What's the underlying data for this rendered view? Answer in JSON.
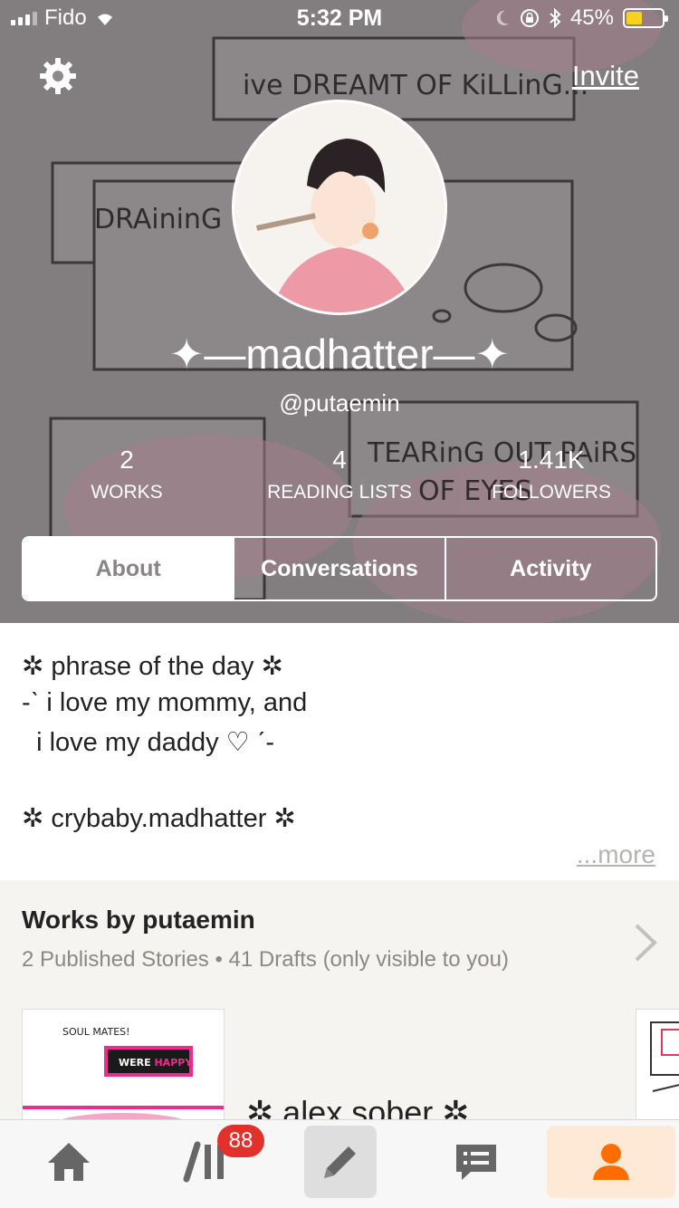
{
  "status_bar": {
    "carrier": "Fido",
    "time": "5:32 PM",
    "battery_percent": "45%",
    "battery_level": 0.45,
    "icons": [
      "signal-icon",
      "wifi-icon",
      "moon-icon",
      "rotation-lock-icon",
      "bluetooth-icon",
      "battery-icon"
    ]
  },
  "header": {
    "settings_icon": "gear-icon",
    "invite_label": "Invite",
    "display_name": "✦—madhatter—✦",
    "username": "@putaemin"
  },
  "stats": [
    {
      "value": "2",
      "label": "WORKS"
    },
    {
      "value": "4",
      "label": "READING LISTS"
    },
    {
      "value": "1.41K",
      "label": "FOLLOWERS"
    }
  ],
  "tabs": [
    {
      "label": "About",
      "active": true
    },
    {
      "label": "Conversations",
      "active": false
    },
    {
      "label": "Activity",
      "active": false
    }
  ],
  "about": {
    "lines": [
      "✲ phrase of the day ✲",
      "-ˋ i love my mommy, and",
      "  i love my daddy ♡ ˊ-",
      "",
      "✲ crybaby.madhatter ✲"
    ],
    "more_label": "...more"
  },
  "works": {
    "title": "Works by putaemin",
    "subtitle": "2 Published Stories • 41 Drafts (only visible to you)",
    "first_story_title": "✲ alex sober ✲",
    "cover_text_1": "SOUL MATES!",
    "cover_text_2_a": "WERE ",
    "cover_text_2_b": "HAPPY."
  },
  "tabbar": {
    "items": [
      "home-icon",
      "library-icon",
      "write-icon",
      "messages-icon",
      "profile-icon"
    ],
    "notification_badge": "88"
  },
  "colors": {
    "accent": "#ff6d00",
    "badge": "#e2302a",
    "tab_active_text": "#8a8585"
  }
}
